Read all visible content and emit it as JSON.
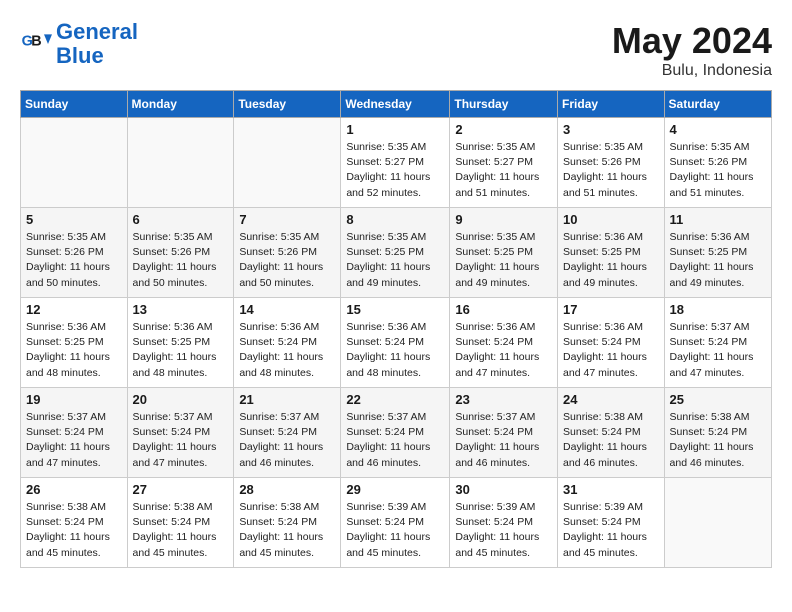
{
  "header": {
    "logo_line1": "General",
    "logo_line2": "Blue",
    "month_year": "May 2024",
    "location": "Bulu, Indonesia"
  },
  "weekdays": [
    "Sunday",
    "Monday",
    "Tuesday",
    "Wednesday",
    "Thursday",
    "Friday",
    "Saturday"
  ],
  "weeks": [
    [
      {
        "day": "",
        "info": ""
      },
      {
        "day": "",
        "info": ""
      },
      {
        "day": "",
        "info": ""
      },
      {
        "day": "1",
        "info": "Sunrise: 5:35 AM\nSunset: 5:27 PM\nDaylight: 11 hours\nand 52 minutes."
      },
      {
        "day": "2",
        "info": "Sunrise: 5:35 AM\nSunset: 5:27 PM\nDaylight: 11 hours\nand 51 minutes."
      },
      {
        "day": "3",
        "info": "Sunrise: 5:35 AM\nSunset: 5:26 PM\nDaylight: 11 hours\nand 51 minutes."
      },
      {
        "day": "4",
        "info": "Sunrise: 5:35 AM\nSunset: 5:26 PM\nDaylight: 11 hours\nand 51 minutes."
      }
    ],
    [
      {
        "day": "5",
        "info": "Sunrise: 5:35 AM\nSunset: 5:26 PM\nDaylight: 11 hours\nand 50 minutes."
      },
      {
        "day": "6",
        "info": "Sunrise: 5:35 AM\nSunset: 5:26 PM\nDaylight: 11 hours\nand 50 minutes."
      },
      {
        "day": "7",
        "info": "Sunrise: 5:35 AM\nSunset: 5:26 PM\nDaylight: 11 hours\nand 50 minutes."
      },
      {
        "day": "8",
        "info": "Sunrise: 5:35 AM\nSunset: 5:25 PM\nDaylight: 11 hours\nand 49 minutes."
      },
      {
        "day": "9",
        "info": "Sunrise: 5:35 AM\nSunset: 5:25 PM\nDaylight: 11 hours\nand 49 minutes."
      },
      {
        "day": "10",
        "info": "Sunrise: 5:36 AM\nSunset: 5:25 PM\nDaylight: 11 hours\nand 49 minutes."
      },
      {
        "day": "11",
        "info": "Sunrise: 5:36 AM\nSunset: 5:25 PM\nDaylight: 11 hours\nand 49 minutes."
      }
    ],
    [
      {
        "day": "12",
        "info": "Sunrise: 5:36 AM\nSunset: 5:25 PM\nDaylight: 11 hours\nand 48 minutes."
      },
      {
        "day": "13",
        "info": "Sunrise: 5:36 AM\nSunset: 5:25 PM\nDaylight: 11 hours\nand 48 minutes."
      },
      {
        "day": "14",
        "info": "Sunrise: 5:36 AM\nSunset: 5:24 PM\nDaylight: 11 hours\nand 48 minutes."
      },
      {
        "day": "15",
        "info": "Sunrise: 5:36 AM\nSunset: 5:24 PM\nDaylight: 11 hours\nand 48 minutes."
      },
      {
        "day": "16",
        "info": "Sunrise: 5:36 AM\nSunset: 5:24 PM\nDaylight: 11 hours\nand 47 minutes."
      },
      {
        "day": "17",
        "info": "Sunrise: 5:36 AM\nSunset: 5:24 PM\nDaylight: 11 hours\nand 47 minutes."
      },
      {
        "day": "18",
        "info": "Sunrise: 5:37 AM\nSunset: 5:24 PM\nDaylight: 11 hours\nand 47 minutes."
      }
    ],
    [
      {
        "day": "19",
        "info": "Sunrise: 5:37 AM\nSunset: 5:24 PM\nDaylight: 11 hours\nand 47 minutes."
      },
      {
        "day": "20",
        "info": "Sunrise: 5:37 AM\nSunset: 5:24 PM\nDaylight: 11 hours\nand 47 minutes."
      },
      {
        "day": "21",
        "info": "Sunrise: 5:37 AM\nSunset: 5:24 PM\nDaylight: 11 hours\nand 46 minutes."
      },
      {
        "day": "22",
        "info": "Sunrise: 5:37 AM\nSunset: 5:24 PM\nDaylight: 11 hours\nand 46 minutes."
      },
      {
        "day": "23",
        "info": "Sunrise: 5:37 AM\nSunset: 5:24 PM\nDaylight: 11 hours\nand 46 minutes."
      },
      {
        "day": "24",
        "info": "Sunrise: 5:38 AM\nSunset: 5:24 PM\nDaylight: 11 hours\nand 46 minutes."
      },
      {
        "day": "25",
        "info": "Sunrise: 5:38 AM\nSunset: 5:24 PM\nDaylight: 11 hours\nand 46 minutes."
      }
    ],
    [
      {
        "day": "26",
        "info": "Sunrise: 5:38 AM\nSunset: 5:24 PM\nDaylight: 11 hours\nand 45 minutes."
      },
      {
        "day": "27",
        "info": "Sunrise: 5:38 AM\nSunset: 5:24 PM\nDaylight: 11 hours\nand 45 minutes."
      },
      {
        "day": "28",
        "info": "Sunrise: 5:38 AM\nSunset: 5:24 PM\nDaylight: 11 hours\nand 45 minutes."
      },
      {
        "day": "29",
        "info": "Sunrise: 5:39 AM\nSunset: 5:24 PM\nDaylight: 11 hours\nand 45 minutes."
      },
      {
        "day": "30",
        "info": "Sunrise: 5:39 AM\nSunset: 5:24 PM\nDaylight: 11 hours\nand 45 minutes."
      },
      {
        "day": "31",
        "info": "Sunrise: 5:39 AM\nSunset: 5:24 PM\nDaylight: 11 hours\nand 45 minutes."
      },
      {
        "day": "",
        "info": ""
      }
    ]
  ]
}
